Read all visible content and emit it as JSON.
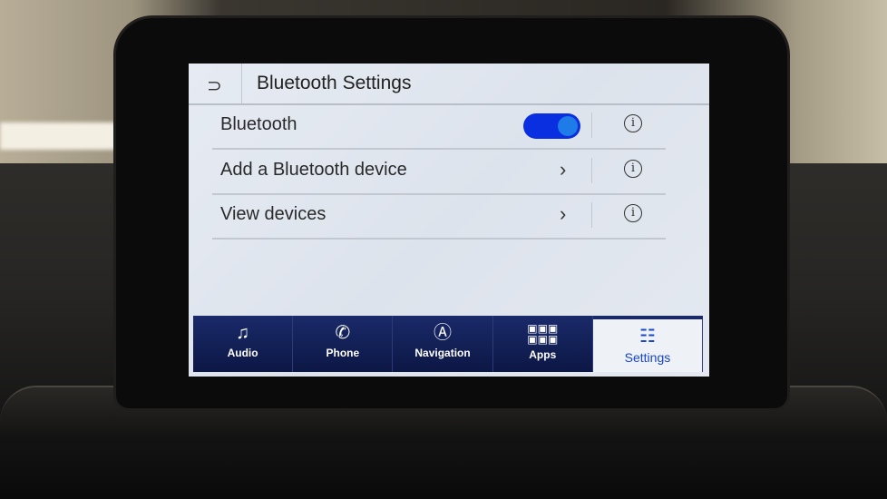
{
  "header": {
    "title": "Bluetooth Settings",
    "back_icon": "back-arrow-icon"
  },
  "rows": [
    {
      "label": "Bluetooth",
      "control": "toggle",
      "toggle_on": true
    },
    {
      "label": "Add a Bluetooth device",
      "control": "chevron"
    },
    {
      "label": "View devices",
      "control": "chevron"
    }
  ],
  "nav": {
    "tabs": [
      {
        "label": "Audio",
        "icon": "music-note-icon"
      },
      {
        "label": "Phone",
        "icon": "phone-icon"
      },
      {
        "label": "Navigation",
        "icon": "navigation-icon"
      },
      {
        "label": "Apps",
        "icon": "apps-grid-icon"
      },
      {
        "label": "Settings",
        "icon": "sliders-icon",
        "active": true
      }
    ]
  },
  "colors": {
    "toggle": "#0a2fe0",
    "nav_bg": "#0c1744",
    "active_tab_text": "#1846c8"
  }
}
